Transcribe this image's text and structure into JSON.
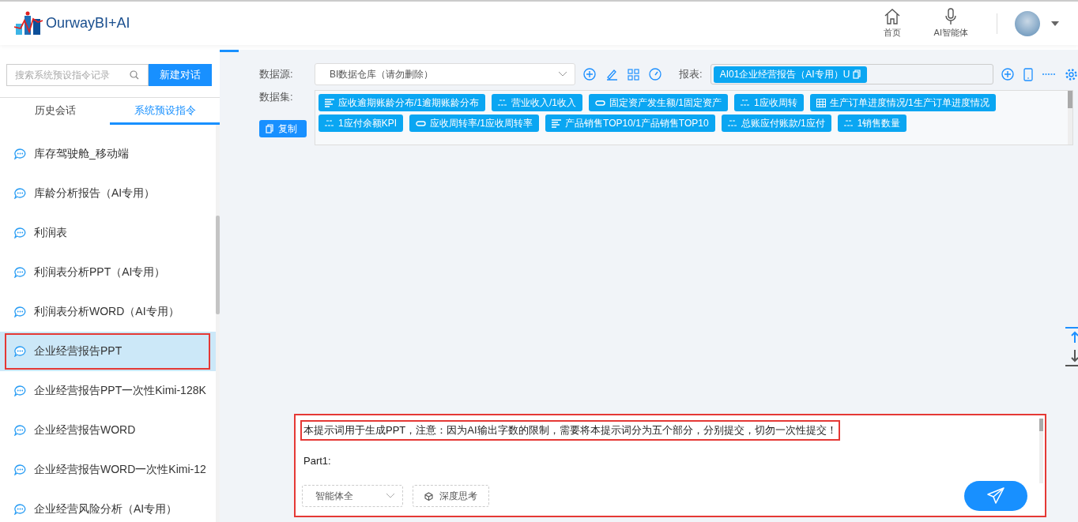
{
  "header": {
    "logo_text": "OurwayBI+AI",
    "nav": [
      {
        "label": "首页",
        "kind": "home"
      },
      {
        "label": "AI智能体",
        "kind": "mic"
      }
    ]
  },
  "sidebar": {
    "search": {
      "placeholder": "搜索系统预设指令记录"
    },
    "new_button": "新建对话",
    "tabs": [
      {
        "label": "历史会话",
        "selected": false
      },
      {
        "label": "系统预设指令",
        "selected": true
      }
    ],
    "items": [
      {
        "label": "库存驾驶舱_移动端",
        "selected": false,
        "highlighted": false
      },
      {
        "label": "库龄分析报告（AI专用）",
        "selected": false,
        "highlighted": false
      },
      {
        "label": "利润表",
        "selected": false,
        "highlighted": false
      },
      {
        "label": "利润表分析PPT（AI专用）",
        "selected": false,
        "highlighted": false
      },
      {
        "label": "利润表分析WORD（AI专用）",
        "selected": false,
        "highlighted": false
      },
      {
        "label": "企业经营报告PPT",
        "selected": true,
        "highlighted": true
      },
      {
        "label": "企业经营报告PPT一次性Kimi-128K",
        "selected": false,
        "highlighted": false
      },
      {
        "label": "企业经营报告WORD",
        "selected": false,
        "highlighted": false
      },
      {
        "label": "企业经营报告WORD一次性Kimi-12",
        "selected": false,
        "highlighted": false
      },
      {
        "label": "企业经营风险分析（AI专用）",
        "selected": false,
        "highlighted": false
      }
    ]
  },
  "toolbar": {
    "datasource_label": "数据源:",
    "datasource_value": "BI数据仓库（请勿删除）",
    "report_label": "报表:",
    "report_chip": "AI01企业经营报告（AI专用）U",
    "dataset_label": "数据集:",
    "copy_button": "复制",
    "datasets": [
      {
        "label": "应收逾期账龄分布/1逾期账龄分布",
        "kind": "bars"
      },
      {
        "label": "营业收入/1收入",
        "kind": "kpi"
      },
      {
        "label": "固定资产发生额/1固定资产",
        "kind": "pill"
      },
      {
        "label": "1应收周转",
        "kind": "kpi"
      },
      {
        "label": "生产订单进度情况/1生产订单进度情况",
        "kind": "table"
      },
      {
        "label": "1应付余额KPI",
        "kind": "kpi"
      },
      {
        "label": "应收周转率/1应收周转率",
        "kind": "pill"
      },
      {
        "label": "产品销售TOP10/1产品销售TOP10",
        "kind": "bars"
      },
      {
        "label": "总账应付账款/1应付",
        "kind": "kpi"
      },
      {
        "label": "1销售数量",
        "kind": "kpi"
      }
    ]
  },
  "prompt": {
    "highlighted": true,
    "lines": [
      {
        "text": "本提示词用于生成PPT，注意：因为AI输出字数的限制，需要将本提示词分为五个部分，分别提交，切勿一次性提交！",
        "highlighted": true
      },
      {
        "text": "Part1:",
        "highlighted": false
      }
    ],
    "agent_select": "智能体全",
    "deep_think": "深度思考"
  }
}
